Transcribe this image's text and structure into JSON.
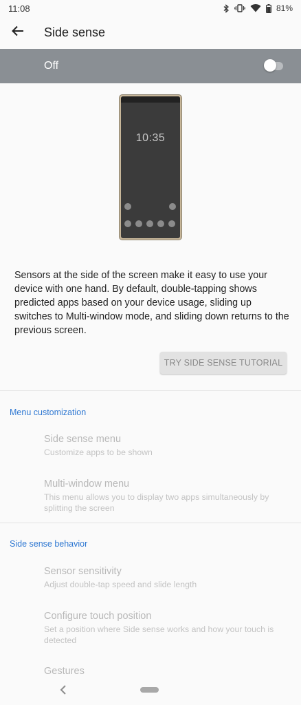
{
  "status_bar": {
    "time": "11:08",
    "battery_percent": "81%",
    "icons": [
      "bluetooth-icon",
      "vibrate-icon",
      "wifi-icon",
      "battery-icon"
    ]
  },
  "app_bar": {
    "title": "Side sense",
    "back_icon": "arrow-left-icon"
  },
  "master_switch": {
    "label": "Off",
    "enabled": false,
    "background_color": "#8a8f94"
  },
  "illustration": {
    "clock_text": "10:35"
  },
  "description": "Sensors at the side of the screen make it easy to use your device with one hand. By default, double-tapping shows predicted apps based on your device usage, sliding up switches to Multi-window mode, and sliding down returns to the previous screen.",
  "tutorial_button": {
    "label": "TRY SIDE SENSE TUTORIAL"
  },
  "sections": {
    "menu_customization": {
      "header": "Menu customization",
      "items": [
        {
          "title": "Side sense menu",
          "summary": "Customize apps to be shown"
        },
        {
          "title": "Multi-window menu",
          "summary": "This menu allows you to display two apps simultaneously by splitting the screen"
        }
      ]
    },
    "side_sense_behavior": {
      "header": "Side sense behavior",
      "items": [
        {
          "title": "Sensor sensitivity",
          "summary": "Adjust double-tap speed and slide length"
        },
        {
          "title": "Configure touch position",
          "summary": "Set a position where Side sense works and how your touch is detected"
        },
        {
          "title": "Gestures",
          "summary": ""
        }
      ]
    }
  },
  "colors": {
    "accent": "#2f78d2",
    "disabled_text": "#b8b8b8"
  },
  "nav_bar": {
    "back_icon": "nav-back-icon",
    "home_icon": "home-pill-icon"
  }
}
